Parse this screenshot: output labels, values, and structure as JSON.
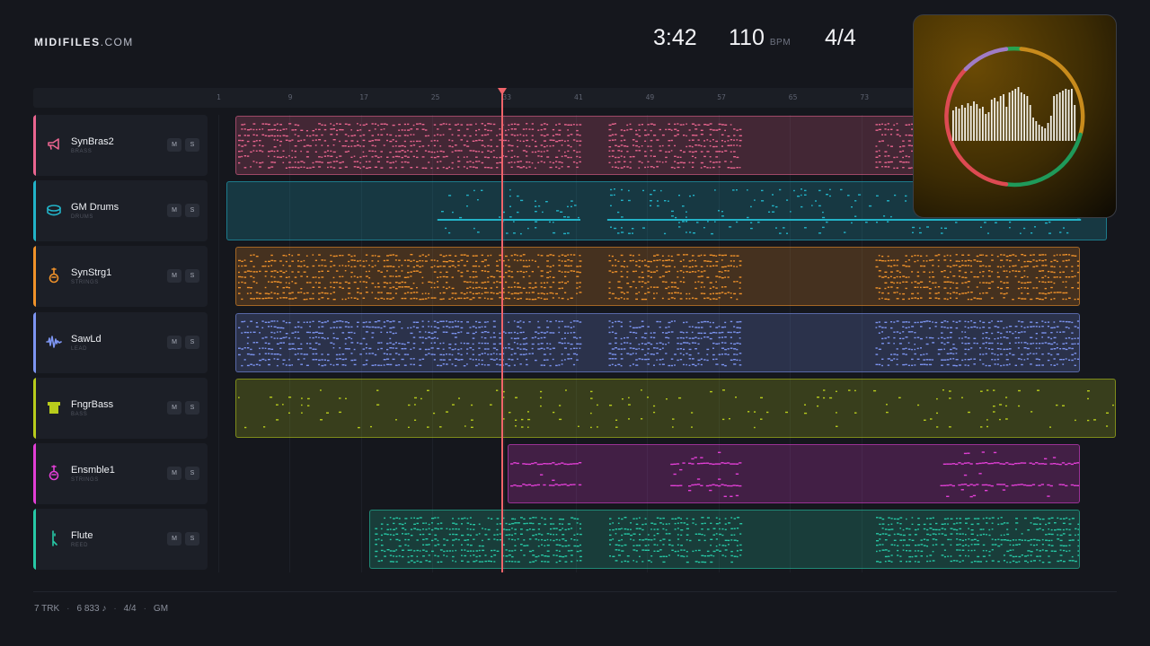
{
  "brand": {
    "bold": "MIDIFILES",
    "domain": ".COM"
  },
  "transport": {
    "time": "3:42",
    "bpm_value": "110",
    "bpm_unit": "BPM",
    "signature": "4/4"
  },
  "ruler": {
    "bars": [
      "1",
      "9",
      "17",
      "25",
      "33",
      "41",
      "49",
      "57",
      "65",
      "73"
    ]
  },
  "playhead_bar": 33,
  "tracks": [
    {
      "name": "SynBras2",
      "category": "BRASS",
      "color": "#e9658f",
      "icon": "trumpet-icon",
      "mute": "M",
      "solo": "S"
    },
    {
      "name": "GM Drums",
      "category": "DRUMS",
      "color": "#22b3c8",
      "icon": "drum-icon",
      "mute": "M",
      "solo": "S"
    },
    {
      "name": "SynStrg1",
      "category": "STRINGS",
      "color": "#f0922a",
      "icon": "violin-icon",
      "mute": "M",
      "solo": "S"
    },
    {
      "name": "SawLd",
      "category": "LEAD",
      "color": "#7d95f2",
      "icon": "waveform-icon",
      "mute": "M",
      "solo": "S"
    },
    {
      "name": "FngrBass",
      "category": "BASS",
      "color": "#b8cc1c",
      "icon": "bass-amp-icon",
      "mute": "M",
      "solo": "S"
    },
    {
      "name": "Ensmble1",
      "category": "STRINGS",
      "color": "#e23fd6",
      "icon": "violin-icon",
      "mute": "M",
      "solo": "S"
    },
    {
      "name": "Flute",
      "category": "REED",
      "color": "#27c9a6",
      "icon": "flute-icon",
      "mute": "M",
      "solo": "S"
    }
  ],
  "footer": {
    "tracks": "7 TRK",
    "notes": "6 833 ♪",
    "signature": "4/4",
    "standard": "GM"
  }
}
